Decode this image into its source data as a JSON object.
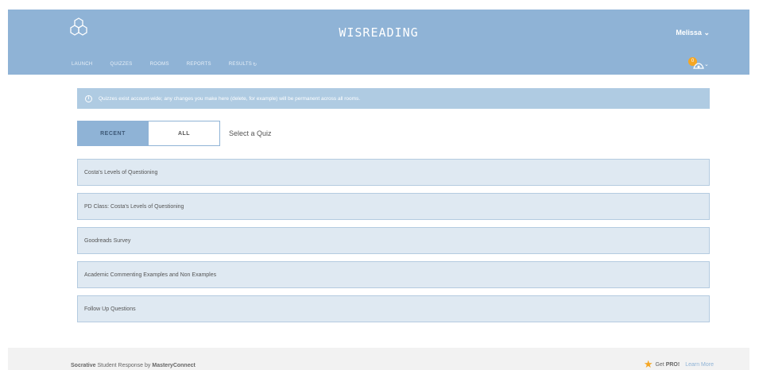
{
  "header": {
    "app_title": "WISREADING",
    "user_name": "Melissa",
    "user_chevron": "⌄",
    "nav": [
      {
        "label": "LAUNCH"
      },
      {
        "label": "QUIZZES"
      },
      {
        "label": "ROOMS"
      },
      {
        "label": "REPORTS"
      },
      {
        "label": "RESULTS"
      }
    ],
    "notification_count": "0",
    "notif_chevron": "⌄"
  },
  "info_banner": {
    "icon_glyph": "i",
    "text": "Quizzes exist account-wide; any changes you make here (delete, for example) will be permanent across all rooms."
  },
  "tabs": {
    "recent": "RECENT",
    "all": "ALL",
    "select_label": "Select a Quiz"
  },
  "quizzes": [
    {
      "name": "Costa's Levels of Questioning"
    },
    {
      "name": "PD Class: Costa's Levels of Questioning"
    },
    {
      "name": "Goodreads Survey"
    },
    {
      "name": "Academic Commenting Examples and Non Examples"
    },
    {
      "name": "Follow Up Questions"
    }
  ],
  "footer": {
    "brand": "Socrative",
    "middle": " Student Response by ",
    "company": "MasteryConnect",
    "star": "★",
    "get": "Get ",
    "pro": "PRO!",
    "learn_more": "Learn More"
  },
  "colors": {
    "header_bg": "#8fb3d6",
    "banner_bg": "#afcbe2",
    "quiz_row_bg": "#dfe9f2",
    "accent_orange": "#f5a623"
  },
  "icons": {
    "logo": "socrative-logo-icon",
    "results": "results-refresh-icon",
    "notifications": "notification-badge-icon",
    "info": "info-icon"
  }
}
